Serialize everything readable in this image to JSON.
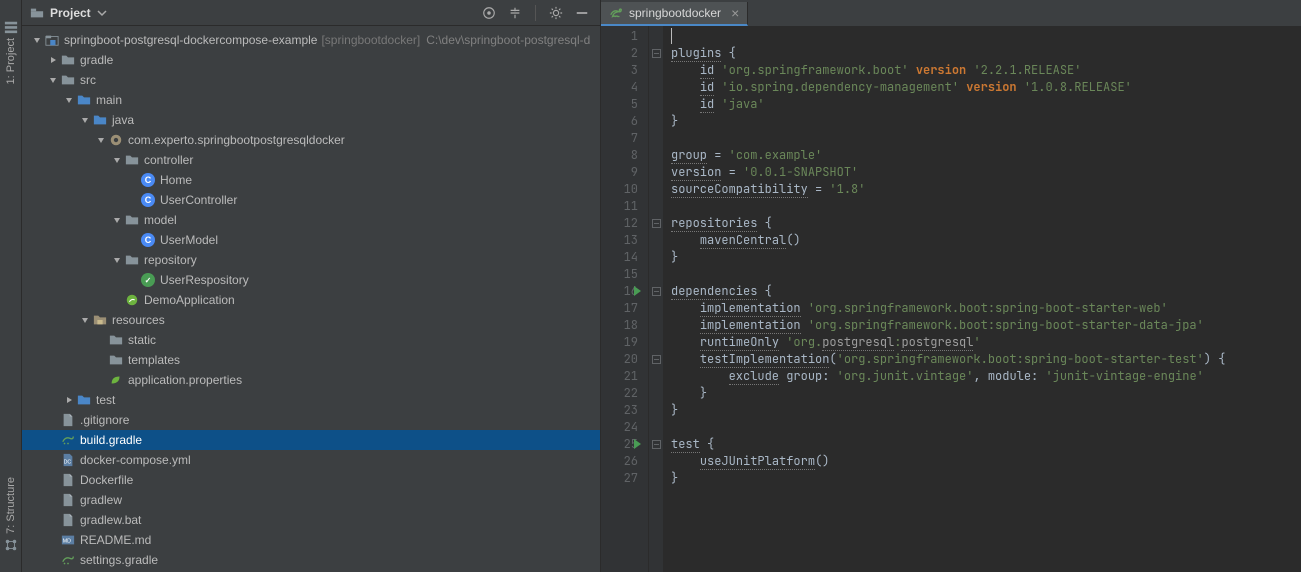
{
  "leftStripe": {
    "project_label": "1: Project",
    "structure_label": "7: Structure"
  },
  "panel": {
    "title": "Project"
  },
  "tree": {
    "root": {
      "name": "springboot-postgresql-dockercompose-example",
      "module": "[springbootdocker]",
      "path": "C:\\dev\\springboot-postgresql-d"
    },
    "items": {
      "gradle": "gradle",
      "src": "src",
      "main": "main",
      "java": "java",
      "pkg": "com.experto.springbootpostgresqldocker",
      "controller": "controller",
      "home": "Home",
      "usercontroller": "UserController",
      "model": "model",
      "usermodel": "UserModel",
      "repository": "repository",
      "userrepository": "UserRespository",
      "demoapp": "DemoApplication",
      "resources": "resources",
      "static": "static",
      "templates": "templates",
      "appprops": "application.properties",
      "test": "test",
      "gitignore": ".gitignore",
      "buildgradle": "build.gradle",
      "dockercompose": "docker-compose.yml",
      "dockerfile": "Dockerfile",
      "gradlew": "gradlew",
      "gradlewbat": "gradlew.bat",
      "readme": "README.md",
      "settingsgradle": "settings.gradle"
    }
  },
  "editor": {
    "tab": {
      "label": "springbootdocker"
    },
    "lines": [
      {
        "n": 1,
        "fold": "",
        "html": "<span class='cursor-line'><span class='caret'></span></span>"
      },
      {
        "n": 2,
        "fold": "minus",
        "html": "<span class='tok-undn'>plugins</span> <span class='tok-br'>{</span>"
      },
      {
        "n": 3,
        "fold": "",
        "html": "    <span class='tok-undn'>id</span> <span class='tok-str'>'org.springframework.boot'</span> <span class='tok-kw'>version</span> <span class='tok-str'>'2.2.1.RELEASE'</span>"
      },
      {
        "n": 4,
        "fold": "",
        "html": "    <span class='tok-undn'>id</span> <span class='tok-str'>'io.spring.dependency-management'</span> <span class='tok-kw'>version</span> <span class='tok-str'>'1.0.8.RELEASE'</span>"
      },
      {
        "n": 5,
        "fold": "",
        "html": "    <span class='tok-undn'>id</span> <span class='tok-str'>'java'</span>"
      },
      {
        "n": 6,
        "fold": "close",
        "html": "<span class='tok-br'>}</span>"
      },
      {
        "n": 7,
        "fold": "",
        "html": ""
      },
      {
        "n": 8,
        "fold": "",
        "html": "<span class='tok-undn'>group</span> <span class='tok-pl'>=</span> <span class='tok-str'>'com.example'</span>"
      },
      {
        "n": 9,
        "fold": "",
        "html": "<span class='tok-undn'>version</span> <span class='tok-pl'>=</span> <span class='tok-str'>'0.0.1-SNAPSHOT'</span>"
      },
      {
        "n": 10,
        "fold": "",
        "html": "<span class='tok-undn'>sourceCompatibility</span> <span class='tok-pl'>=</span> <span class='tok-str'>'1.8'</span>"
      },
      {
        "n": 11,
        "fold": "",
        "html": ""
      },
      {
        "n": 12,
        "fold": "minus",
        "html": "<span class='tok-undn'>repositories</span> <span class='tok-br'>{</span>"
      },
      {
        "n": 13,
        "fold": "",
        "html": "    <span class='tok-undn'>mavenCentral</span><span class='tok-pl'>()</span>"
      },
      {
        "n": 14,
        "fold": "close",
        "html": "<span class='tok-br'>}</span>"
      },
      {
        "n": 15,
        "fold": "",
        "html": ""
      },
      {
        "n": 16,
        "fold": "minus",
        "run": true,
        "html": "<span class='tok-undn'>dependencies</span> <span class='tok-br'>{</span>"
      },
      {
        "n": 17,
        "fold": "",
        "html": "    <span class='tok-undn'>implementation</span> <span class='tok-str'>'org.springframework.boot:spring-boot-starter-web'</span>"
      },
      {
        "n": 18,
        "fold": "",
        "html": "    <span class='tok-undn'>implementation</span> <span class='tok-str'>'org.springframework.boot:spring-boot-starter-data-jpa'</span>"
      },
      {
        "n": 19,
        "fold": "",
        "html": "    <span class='tok-undn'>runtimeOnly</span> <span class='tok-str'>'org.</span><span class='tok-und'>postgresql</span><span class='tok-str'>:</span><span class='tok-und'>postgresql</span><span class='tok-str'>'</span>"
      },
      {
        "n": 20,
        "fold": "minus",
        "html": "    <span class='tok-undn'>testImplementation</span><span class='tok-pl'>(</span><span class='tok-str'>'org.springframework.boot:spring-boot-starter-test'</span><span class='tok-pl'>)</span> <span class='tok-br'>{</span>"
      },
      {
        "n": 21,
        "fold": "",
        "html": "        <span class='tok-undn'>exclude</span> <span class='tok-pl'>group: </span><span class='tok-str'>'org.junit.vintage'</span><span class='tok-pl'>, module: </span><span class='tok-str'>'junit-vintage-engine'</span>"
      },
      {
        "n": 22,
        "fold": "close",
        "html": "    <span class='tok-br'>}</span>"
      },
      {
        "n": 23,
        "fold": "close",
        "html": "<span class='tok-br'>}</span>"
      },
      {
        "n": 24,
        "fold": "",
        "html": ""
      },
      {
        "n": 25,
        "fold": "minus",
        "run": true,
        "html": "<span class='tok-undn'>test</span> <span class='tok-br'>{</span>"
      },
      {
        "n": 26,
        "fold": "",
        "html": "    <span class='tok-undn'>useJUnitPlatform</span><span class='tok-pl'>()</span>"
      },
      {
        "n": 27,
        "fold": "close",
        "html": "<span class='tok-br'>}</span>"
      }
    ]
  }
}
